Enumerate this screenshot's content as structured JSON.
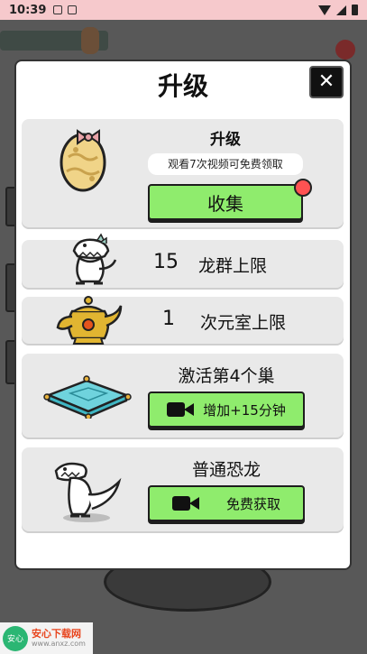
{
  "status_bar": {
    "time": "10:39"
  },
  "modal": {
    "title": "升级",
    "close_glyph": "✕",
    "cards": {
      "upgrade": {
        "title": "升级",
        "hint": "观看7次视频可免费领取",
        "button_label": "收集",
        "has_notification_dot": true
      },
      "dragon_limit": {
        "value": "15",
        "label": "龙群上限"
      },
      "room_limit": {
        "value": "1",
        "label": "次元室上限"
      },
      "nest": {
        "title": "激活第4个巢",
        "button_label": "增加+15分钟",
        "button_icon": "video-camera-icon"
      },
      "dino": {
        "title": "普通恐龙",
        "button_label": "免费获取",
        "button_icon": "video-camera-icon"
      }
    }
  },
  "watermark": {
    "title": "安心下载网",
    "url": "www.anxz.com",
    "logo_text": "安心"
  },
  "colors": {
    "accent_green": "#8fec6d",
    "notification_red": "#ff5252",
    "modal_bg": "#ffffff",
    "card_bg": "#e9e9e9"
  }
}
